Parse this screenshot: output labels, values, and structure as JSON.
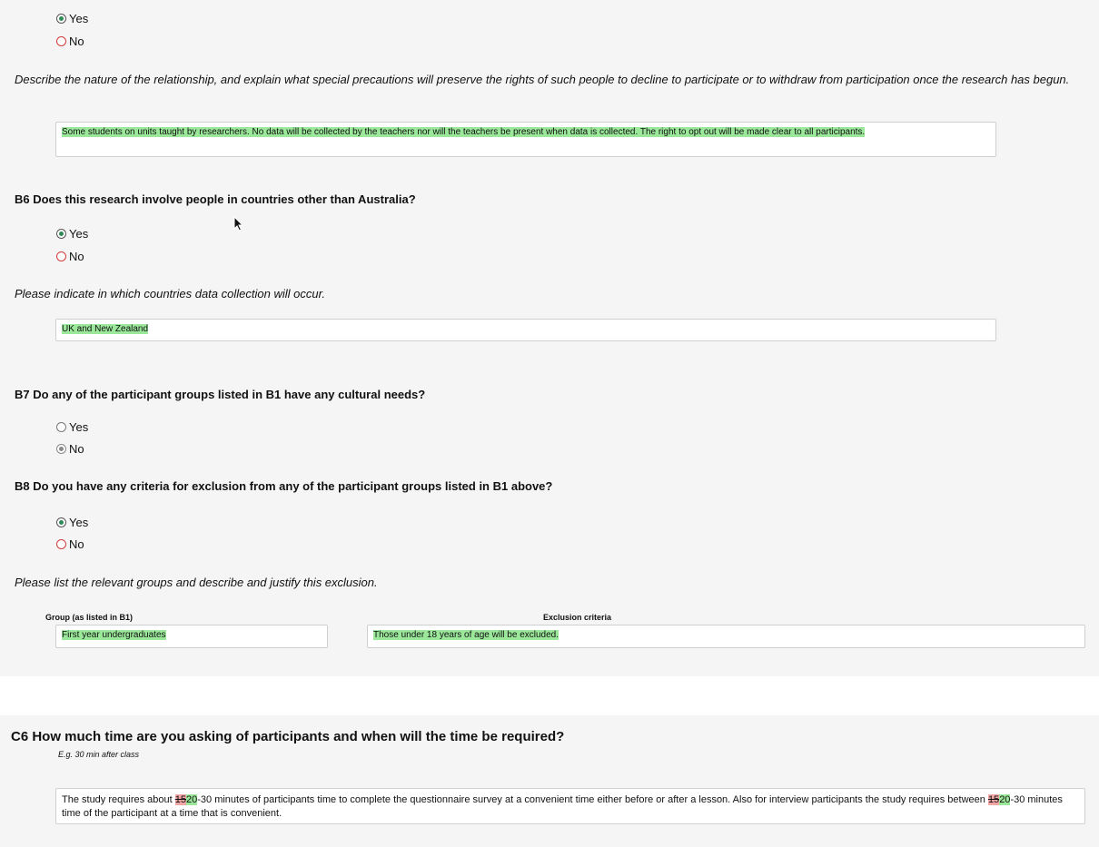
{
  "top_radio": {
    "yes": "Yes",
    "no": "No"
  },
  "relationship_prompt": "Describe the nature of the relationship, and explain what special precautions will preserve the rights of such people to decline to participate or to withdraw from participation once the research has begun.",
  "relationship_answer": "Some students on units taught by researchers. No data will be collected by the teachers nor will the teachers be present when data is collected. The right to opt out will be made clear to all participants.",
  "b6": {
    "question": "B6  Does this research involve people in countries other than Australia?",
    "yes": "Yes",
    "no": "No",
    "prompt": "Please indicate in which countries data collection will occur.",
    "answer": "UK and New Zealand"
  },
  "b7": {
    "question": "B7  Do any of the participant groups listed in B1 have any cultural needs?",
    "yes": "Yes",
    "no": "No"
  },
  "b8": {
    "question": "B8  Do you have any criteria for exclusion from any of the participant groups listed in B1 above?",
    "yes": "Yes",
    "no": "No",
    "prompt": "Please list the relevant groups and describe and justify this exclusion.",
    "group_label": "Group (as listed in B1)",
    "criteria_label": "Exclusion criteria",
    "group_value": "First year undergraduates",
    "criteria_value": "Those under 18 years of age will be excluded."
  },
  "c6": {
    "question": "C6  How much time are you asking of participants and when will the time be required?",
    "hint": "E.g. 30 min after class",
    "answer_part1": "The study requires about ",
    "answer_del1": "15",
    "answer_ins1": "20",
    "answer_part2": "-30 minutes of participants time to complete the questionnaire survey at a convenient time either before or after a lesson. Also for interview participants the study requires between ",
    "answer_del2": "15",
    "answer_ins2": "20",
    "answer_part3": "-30 minutes time of the participant at a time that is convenient."
  },
  "colors": {
    "selected": "#2e8b57",
    "unselected_required": "#d23c3c",
    "highlight": "#9be89b",
    "deletion": "#f3a6a6"
  }
}
